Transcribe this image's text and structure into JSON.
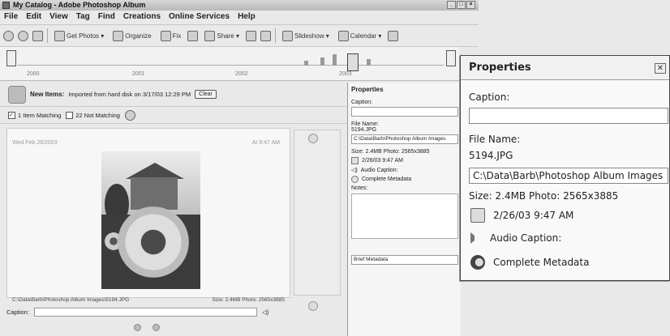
{
  "window": {
    "title": "My Catalog - Adobe Photoshop Album",
    "controls": [
      "_",
      "□",
      "×"
    ]
  },
  "menu": [
    "File",
    "Edit",
    "View",
    "Tag",
    "Find",
    "Creations",
    "Online Services",
    "Help"
  ],
  "toolbar": {
    "get_photos": "Get Photos ▾",
    "organize": "Organize",
    "fix": "Fix",
    "share": "Share ▾",
    "slideshow": "Slideshow ▾",
    "calendar": "Calendar ▾"
  },
  "timeline": {
    "years": [
      "2000",
      "2001",
      "2002",
      "2003"
    ]
  },
  "new_items": {
    "label": "New Items:",
    "text": "Imported from hard disk on 3/17/03 12:29 PM",
    "clear": "Clear"
  },
  "matching": {
    "matching": "1 Item Matching",
    "not_matching": "22 Not Matching"
  },
  "photo_card": {
    "date": "Wed Feb 26/2003",
    "time": "At 9:47 AM",
    "path": "C:\\Data\\Barb\\Photoshop Album Images\\5194.JPG",
    "size": "Size: 2.4MB  Photo: 2565x3885"
  },
  "caption_bar": {
    "label": "Caption:"
  },
  "properties_small": {
    "title": "Properties",
    "caption_label": "Caption:",
    "filename_label": "File Name:",
    "filename": "5194.JPG",
    "path": "C:\\Data\\Barb\\Photoshop Album Images",
    "size": "Size: 2.4MB  Photo: 2565x3885",
    "date": "2/26/03 9:47 AM",
    "audio": "Audio Caption:",
    "metadata": "Complete Metadata",
    "notes_label": "Notes:",
    "brief": "Brief Metadata"
  },
  "properties_zoom": {
    "title": "Properties",
    "caption_label": "Caption:",
    "filename_label": "File Name:",
    "filename": "5194.JPG",
    "path": "C:\\Data\\Barb\\Photoshop Album Images",
    "size": "Size: 2.4MB  Photo: 2565x3885",
    "date": "2/26/03 9:47 AM",
    "audio": "Audio Caption:",
    "metadata": "Complete Metadata",
    "close": "✕"
  }
}
